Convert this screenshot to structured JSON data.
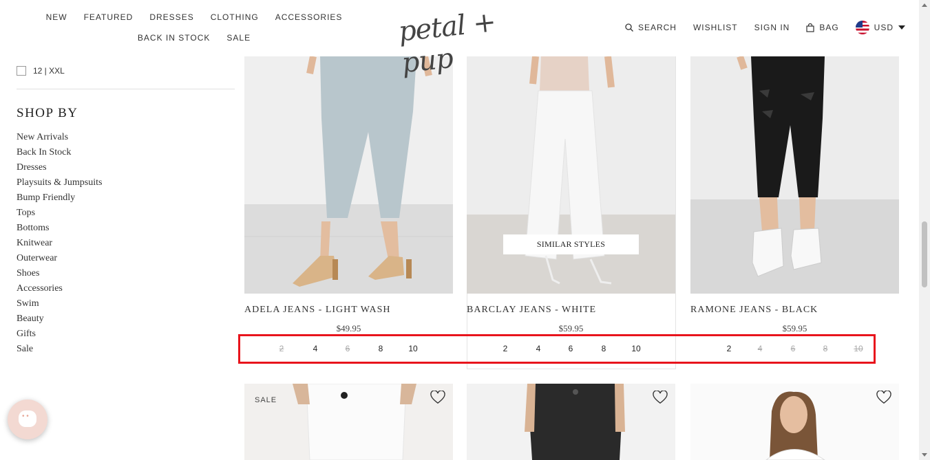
{
  "header": {
    "nav": [
      "NEW",
      "FEATURED",
      "DRESSES",
      "CLOTHING",
      "ACCESSORIES",
      "BACK IN STOCK",
      "SALE"
    ],
    "logo_text": "petal + pup",
    "search": "SEARCH",
    "wishlist": "WISHLIST",
    "sign_in": "SIGN IN",
    "bag": "BAG",
    "currency": "USD"
  },
  "sidebar": {
    "size_option": "12 | XXL",
    "shop_by_title": "SHOP BY",
    "shop_by": [
      "New Arrivals",
      "Back In Stock",
      "Dresses",
      "Playsuits & Jumpsuits",
      "Bump Friendly",
      "Tops",
      "Bottoms",
      "Knitwear",
      "Outerwear",
      "Shoes",
      "Accessories",
      "Swim",
      "Beauty",
      "Gifts",
      "Sale"
    ]
  },
  "products": [
    {
      "name": "ADELA JEANS - LIGHT WASH",
      "price": "$49.95",
      "sizes": [
        {
          "label": "2",
          "available": false
        },
        {
          "label": "4",
          "available": true
        },
        {
          "label": "6",
          "available": false
        },
        {
          "label": "8",
          "available": true
        },
        {
          "label": "10",
          "available": true
        }
      ]
    },
    {
      "name": "BARCLAY JEANS - WHITE",
      "price": "$59.95",
      "similar_styles": "SIMILAR STYLES",
      "sizes": [
        {
          "label": "2",
          "available": true
        },
        {
          "label": "4",
          "available": true
        },
        {
          "label": "6",
          "available": true
        },
        {
          "label": "8",
          "available": true
        },
        {
          "label": "10",
          "available": true
        }
      ]
    },
    {
      "name": "RAMONE JEANS - BLACK",
      "price": "$59.95",
      "sizes": [
        {
          "label": "2",
          "available": true
        },
        {
          "label": "4",
          "available": false
        },
        {
          "label": "6",
          "available": false
        },
        {
          "label": "8",
          "available": false
        },
        {
          "label": "10",
          "available": false
        }
      ]
    }
  ],
  "row2": {
    "sale_tag": "SALE"
  },
  "colors": {
    "highlight": "#e8141c",
    "text": "#222222",
    "out_of_stock": "#aaaaaa"
  }
}
